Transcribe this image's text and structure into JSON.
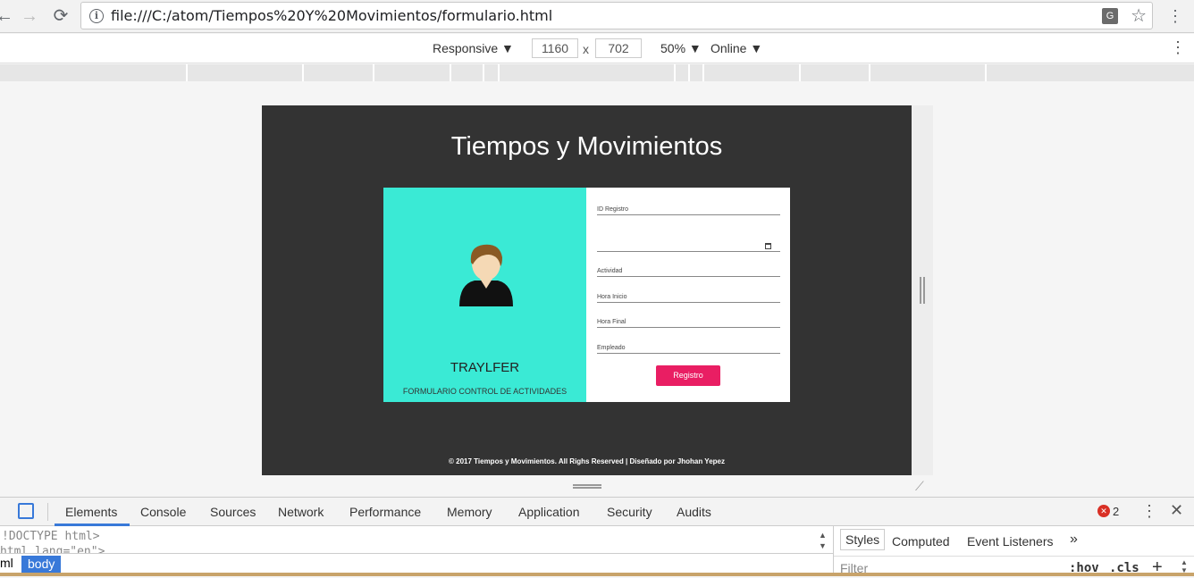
{
  "browser": {
    "back_icon": "arrow-left",
    "forward_icon": "arrow-right",
    "reload_icon": "reload",
    "url": "file:///C:/atom/Tiempos%20Y%20Movimientos/formulario.html"
  },
  "device_toolbar": {
    "mode": "Responsive ▼",
    "width": "1160",
    "x": "x",
    "height": "702",
    "zoom": "50% ▼",
    "network": "Online ▼"
  },
  "site": {
    "title": "Tiempos y Movimientos",
    "brand": "TRAYLFER",
    "brand_subtitle": "FORMULARIO CONTROL DE ACTIVIDADES",
    "fields": {
      "id_registro": "ID Registro",
      "date": "",
      "actividad": "Actividad",
      "hora_inicio": "Hora Inicio",
      "hora_final": "Hora Final",
      "empleado": "Empleado"
    },
    "submit": "Registro",
    "footer": "© 2017 Tiempos y Movimientos. All Righs Reserved | Diseñado por Jhohan Yepez",
    "colors": {
      "background": "#333333",
      "card_left": "#3aead5",
      "button": "#e91e63"
    }
  },
  "devtools": {
    "tabs": [
      "Elements",
      "Console",
      "Sources",
      "Network",
      "Performance",
      "Memory",
      "Application",
      "Security",
      "Audits"
    ],
    "active_tab": "Elements",
    "error_count": "2",
    "code_line_1": "!DOCTYPE html>",
    "code_line_2": "html lang=\"en\">",
    "breadcrumb_html": "ml",
    "breadcrumb_body": "body",
    "side_tabs": [
      "Styles",
      "Computed",
      "Event Listeners"
    ],
    "side_more": "»",
    "filter_placeholder": "Filter",
    "hov": ":hov",
    "cls": ".cls",
    "plus": "+"
  }
}
